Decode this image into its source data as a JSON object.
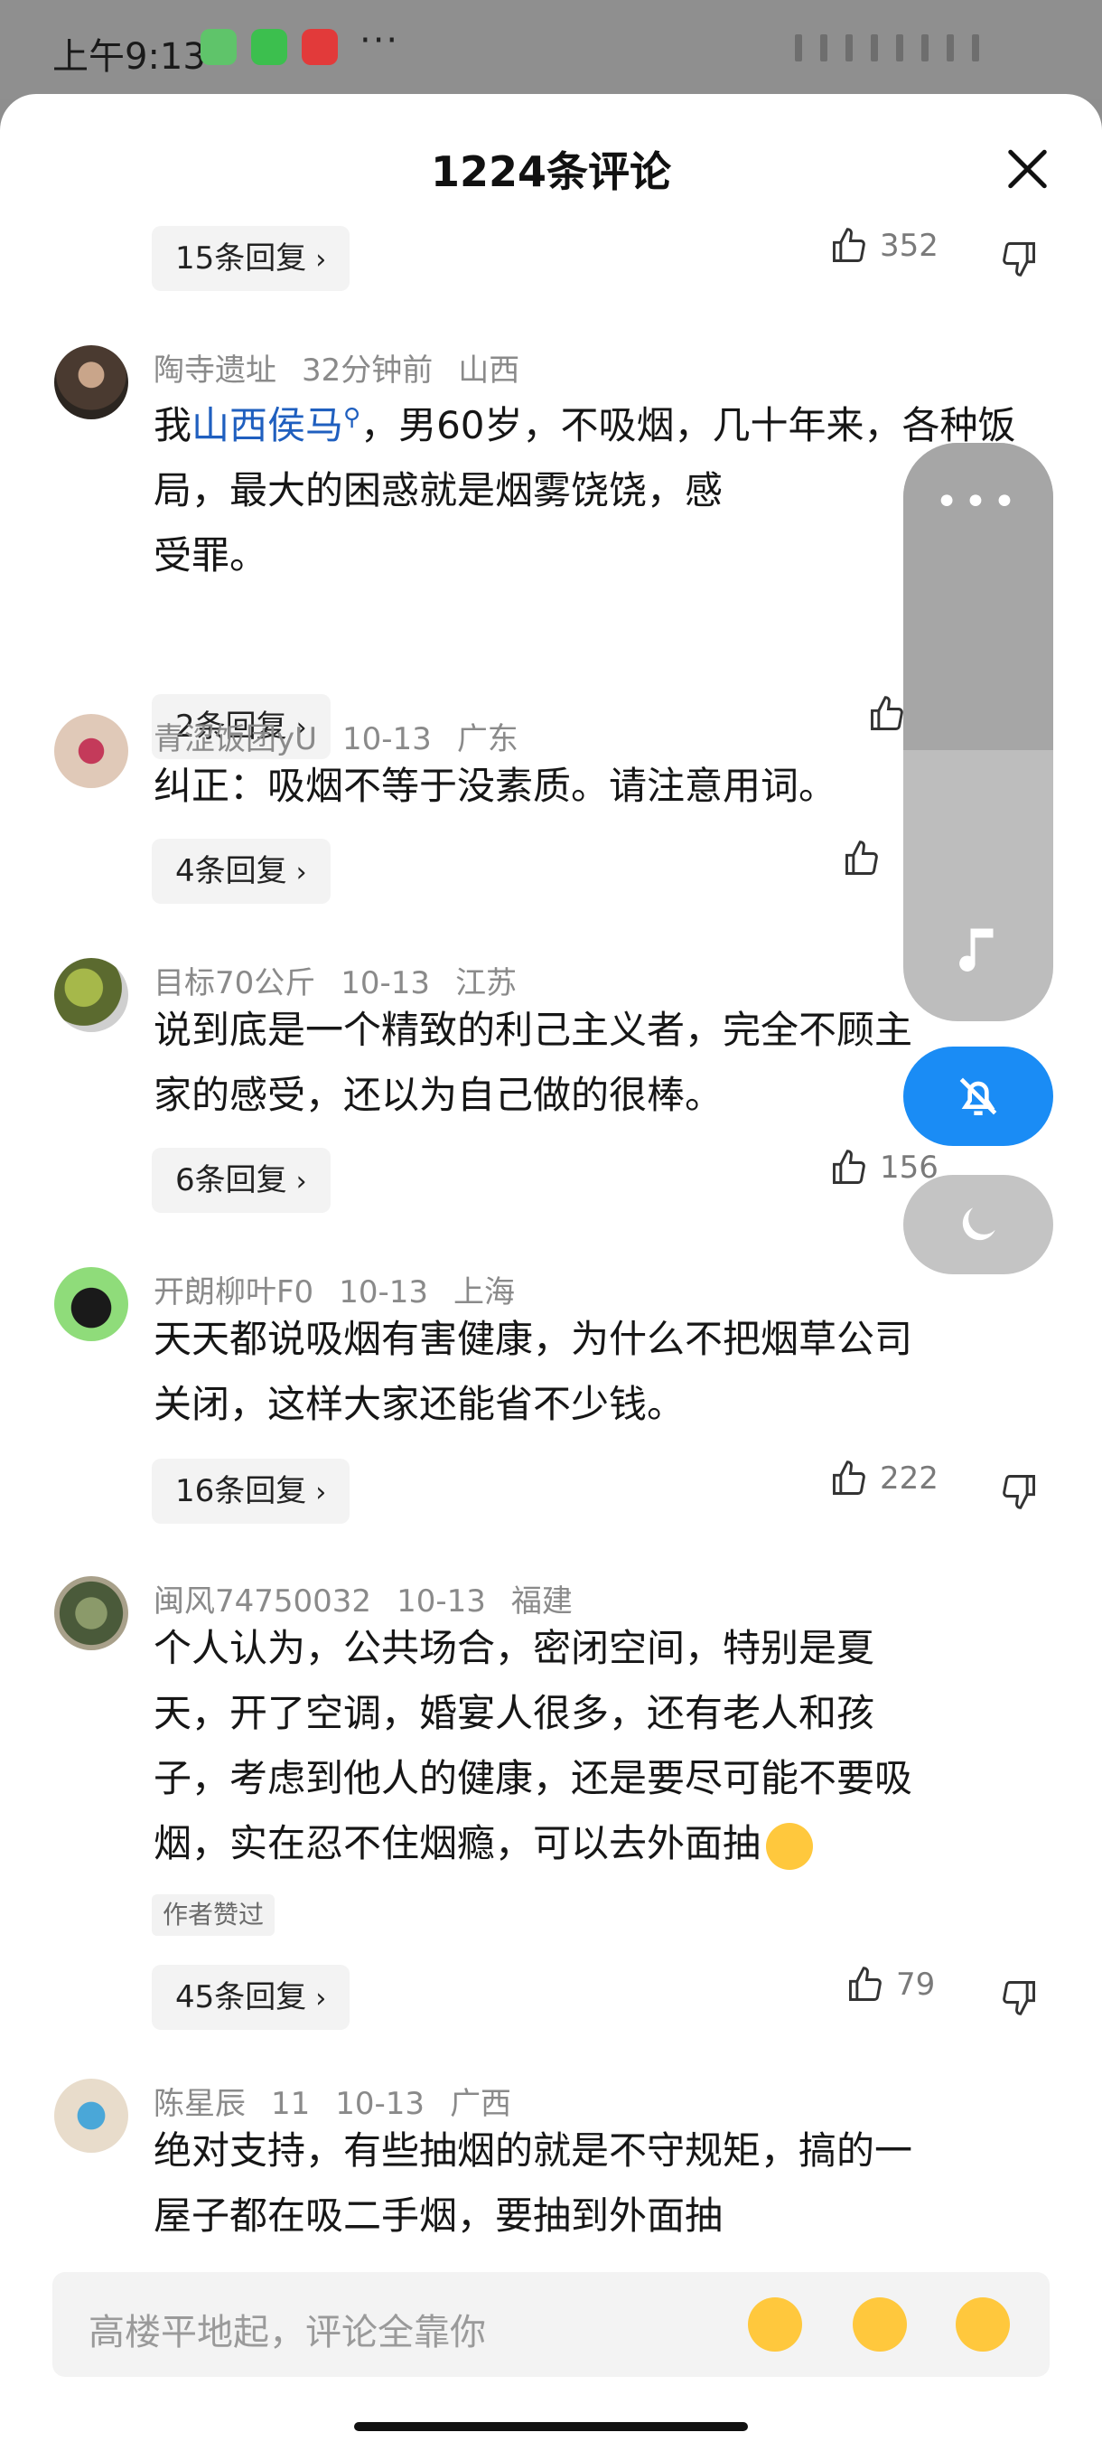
{
  "status": {
    "time": "上午9:13",
    "more": "···"
  },
  "sheet": {
    "title": "1224条评论",
    "input_placeholder": "高楼平地起，评论全靠你"
  },
  "top_reply": {
    "label": "15条回复",
    "likes": "352"
  },
  "comments": [
    {
      "user": "陶寺遗址",
      "time": "32分钟前",
      "location": "山西",
      "text_pre": "我",
      "mention": "山西侯马",
      "text_post": "，男60岁，不吸烟，几十年来，各种饭局，最大的困惑就是烟雾饶饶，感\n受罪。",
      "reply": "2条回复",
      "likes": ""
    },
    {
      "user": "青涩饭团yU",
      "time": "10-13",
      "location": "广东",
      "text": "纠正：吸烟不等于没素质。请注意用词。",
      "reply": "4条回复",
      "likes": ""
    },
    {
      "user": "目标70公斤",
      "time": "10-13",
      "location": "江苏",
      "text": "说到底是一个精致的利己主义者，完全不顾主\n家的感受，还以为自己做的很棒。",
      "reply": "6条回复",
      "likes": "156"
    },
    {
      "user": "开朗柳叶F0",
      "time": "10-13",
      "location": "上海",
      "text": "天天都说吸烟有害健康，为什么不把烟草公司\n关闭，这样大家还能省不少钱。",
      "reply": "16条回复",
      "likes": "222"
    },
    {
      "user": "闽风74750032",
      "time": "10-13",
      "location": "福建",
      "text": "个人认为，公共场合，密闭空间，特别是夏\n天，开了空调，婚宴人很多，还有老人和孩\n子，考虑到他人的健康，还是要尽可能不要吸\n烟，实在忍不住烟瘾，可以去外面抽",
      "tag": "作者赞过",
      "reply": "45条回复",
      "likes": "79"
    },
    {
      "user": "陈星辰",
      "level": "11",
      "time": "10-13",
      "location": "广西",
      "text": "绝对支持，有些抽烟的就是不守规矩，搞的一\n屋子都在吸二手烟，要抽到外面抽"
    }
  ],
  "colors": {
    "mention": "#1f5fbf",
    "bell_button": "#1a8cf5"
  },
  "icons": [
    "thumb-up-icon",
    "thumb-down-icon",
    "close-icon",
    "chevron-right-icon",
    "music-note-icon",
    "bell-off-icon",
    "moon-icon",
    "emoji-icon"
  ]
}
